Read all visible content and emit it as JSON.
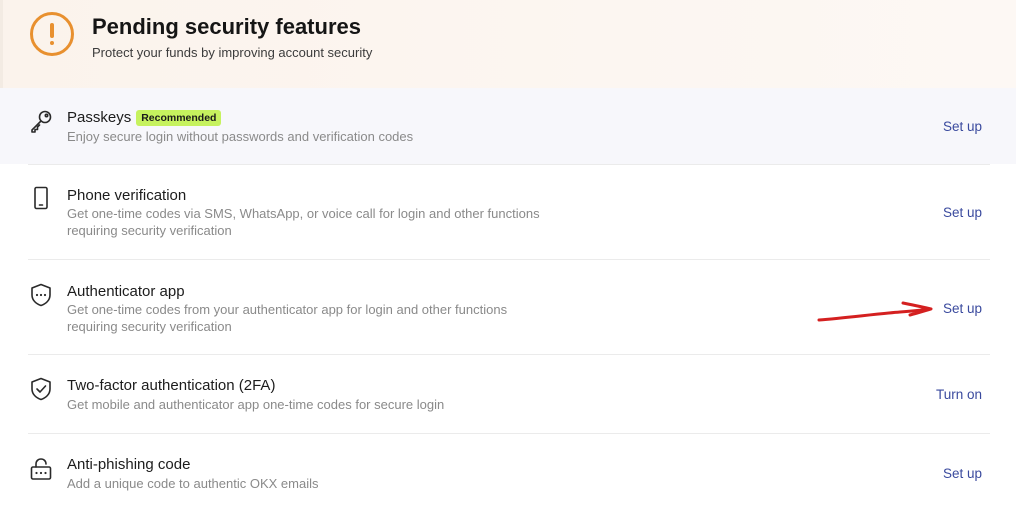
{
  "header": {
    "title": "Pending security features",
    "subtitle": "Protect your funds by improving account security",
    "icon": "warning-circle-icon",
    "accent_color": "#e8902f"
  },
  "features": [
    {
      "title": "Passkeys",
      "badge": "Recommended",
      "description": "Enjoy secure login without passwords and verification codes",
      "action": "Set up",
      "icon": "key-icon"
    },
    {
      "title": "Phone verification",
      "description_line1": "Get one-time codes via SMS, WhatsApp, or voice call for login and other functions",
      "description_line2": "requiring security verification",
      "action": "Set up",
      "icon": "phone-icon"
    },
    {
      "title": "Authenticator app",
      "description_line1": "Get one-time codes from your authenticator app for login and other functions",
      "description_line2": "requiring security verification",
      "action": "Set up",
      "icon": "shield-password-icon"
    },
    {
      "title": "Two-factor authentication (2FA)",
      "description": "Get mobile and authenticator app one-time codes for secure login",
      "action": "Turn on",
      "icon": "shield-check-icon"
    },
    {
      "title": "Anti-phishing code",
      "description": "Add a unique code to authentic OKX emails",
      "action": "Set up",
      "icon": "lock-password-icon"
    }
  ],
  "colors": {
    "link": "#3a4a9e",
    "badge_bg": "#c6f25e",
    "annotation": "#d42020"
  }
}
